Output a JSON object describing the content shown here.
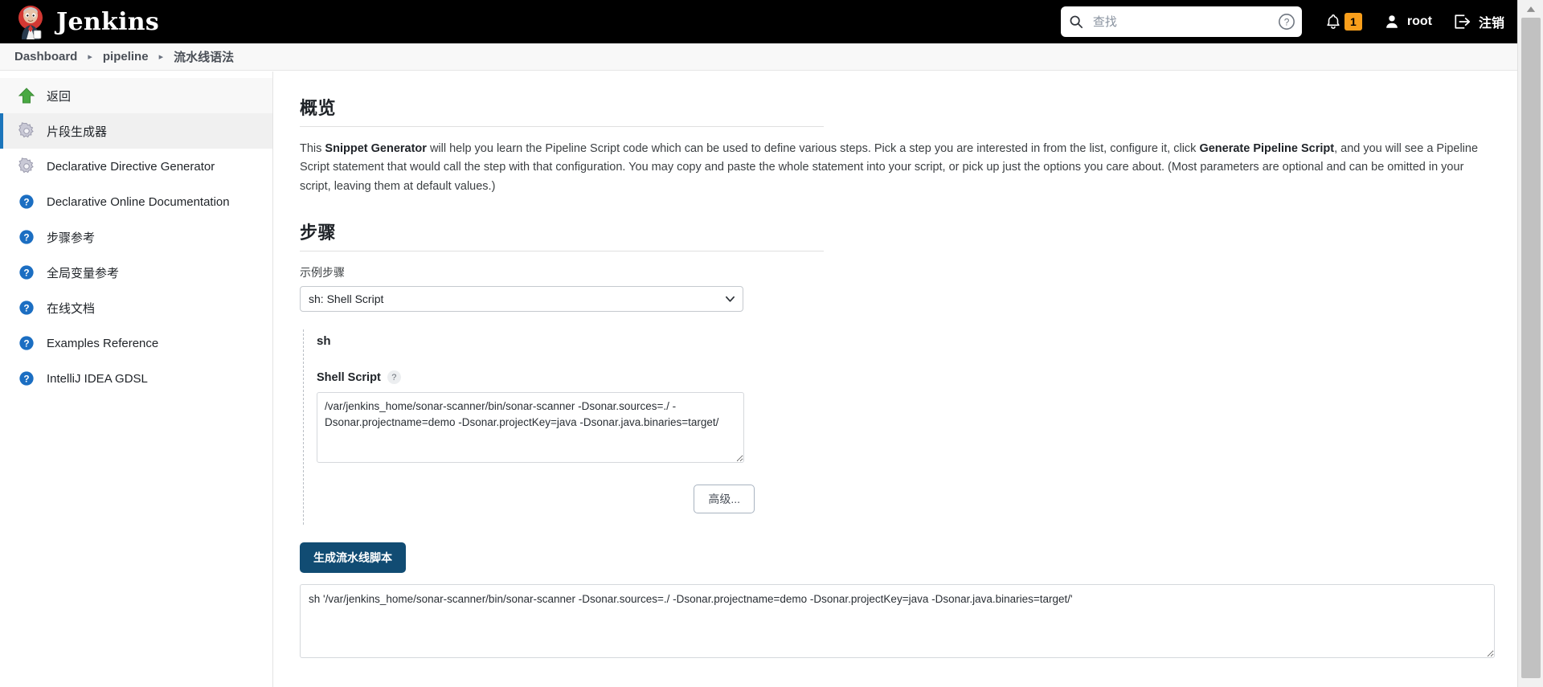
{
  "topbar": {
    "logo_text": "Jenkins",
    "search": {
      "placeholder": "查找",
      "value": ""
    },
    "notification_count": "1",
    "user_name": "root",
    "logout_label": "注销"
  },
  "breadcrumb": {
    "items": [
      {
        "label": "Dashboard"
      },
      {
        "label": "pipeline"
      },
      {
        "label": "流水线语法"
      }
    ],
    "separator": "▸"
  },
  "sidebar": {
    "items": [
      {
        "label": "返回",
        "icon": "up-arrow-icon"
      },
      {
        "label": "片段生成器",
        "icon": "gear-icon"
      },
      {
        "label": "Declarative Directive Generator",
        "icon": "gear-icon"
      },
      {
        "label": "Declarative Online Documentation",
        "icon": "help-icon"
      },
      {
        "label": "步骤参考",
        "icon": "help-icon"
      },
      {
        "label": "全局变量参考",
        "icon": "help-icon"
      },
      {
        "label": "在线文档",
        "icon": "help-icon"
      },
      {
        "label": "Examples Reference",
        "icon": "help-icon"
      },
      {
        "label": "IntelliJ IDEA GDSL",
        "icon": "help-icon"
      }
    ]
  },
  "main": {
    "overview": {
      "title": "概览",
      "text_part1": "This ",
      "bold1": "Snippet Generator",
      "text_part2": " will help you learn the Pipeline Script code which can be used to define various steps. Pick a step you are interested in from the list, configure it, click ",
      "bold2": "Generate Pipeline Script",
      "text_part3": ", and you will see a Pipeline Script statement that would call the step with that configuration. You may copy and paste the whole statement into your script, or pick up just the options you care about. (Most parameters are optional and can be omitted in your script, leaving them at default values.)"
    },
    "steps": {
      "title": "步骤",
      "select_label": "示例步骤",
      "selected_step": "sh: Shell Script",
      "step_options": [
        "sh: Shell Script"
      ]
    },
    "step_form": {
      "step_name": "sh",
      "param_label": "Shell Script",
      "help_glyph": "?",
      "script_value": "/var/jenkins_home/sonar-scanner/bin/sonar-scanner -Dsonar.sources=./ -Dsonar.projectname=demo -Dsonar.projectKey=java -Dsonar.java.binaries=target/",
      "advanced_label": "高级..."
    },
    "generate_button": "生成流水线脚本",
    "result_value": "sh '/var/jenkins_home/sonar-scanner/bin/sonar-scanner -Dsonar.sources=./ -Dsonar.projectname=demo -Dsonar.projectKey=java -Dsonar.java.binaries=target/'"
  },
  "colors": {
    "topbar_bg": "#000000",
    "accent_blue": "#1b75bb",
    "primary_button": "#114c73",
    "badge_orange": "#fa9f1b"
  }
}
